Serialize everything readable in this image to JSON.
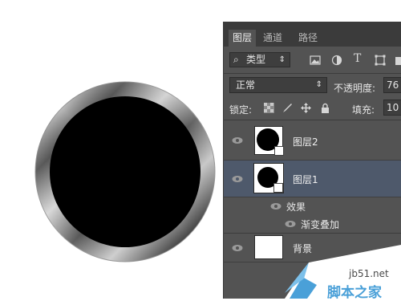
{
  "panel": {
    "tabs": [
      {
        "label": "图层",
        "active": true
      },
      {
        "label": "通道",
        "active": false
      },
      {
        "label": "路径",
        "active": false
      }
    ],
    "filter": {
      "label": "类型",
      "icons": [
        "image-filter-icon",
        "adjustment-filter-icon",
        "type-filter-icon",
        "shape-filter-icon",
        "smart-object-filter-icon"
      ]
    },
    "blend_mode": "正常",
    "opacity_label": "不透明度:",
    "opacity_value": "76",
    "lock_label": "锁定:",
    "lock_icons": [
      "lock-transparency-icon",
      "lock-paint-icon",
      "lock-position-icon",
      "lock-all-icon"
    ],
    "fill_label": "填充:",
    "fill_value": "10",
    "layers": [
      {
        "name": "图层2",
        "selected": false,
        "thumb": "circle",
        "visible": true
      },
      {
        "name": "图层1",
        "selected": true,
        "thumb": "circle",
        "visible": true,
        "effects_label": "效果",
        "effects": [
          {
            "name": "渐变叠加",
            "visible": true
          }
        ]
      },
      {
        "name": "背景",
        "selected": false,
        "thumb": "white",
        "visible": true
      }
    ]
  },
  "watermark": {
    "site": "jb51.net",
    "text": "脚本之家"
  },
  "colors": {
    "panel_bg": "#535353",
    "selected_layer": "#4e596b",
    "tab_bar": "#3b3b3b",
    "watermark": "#4aa0d8"
  }
}
